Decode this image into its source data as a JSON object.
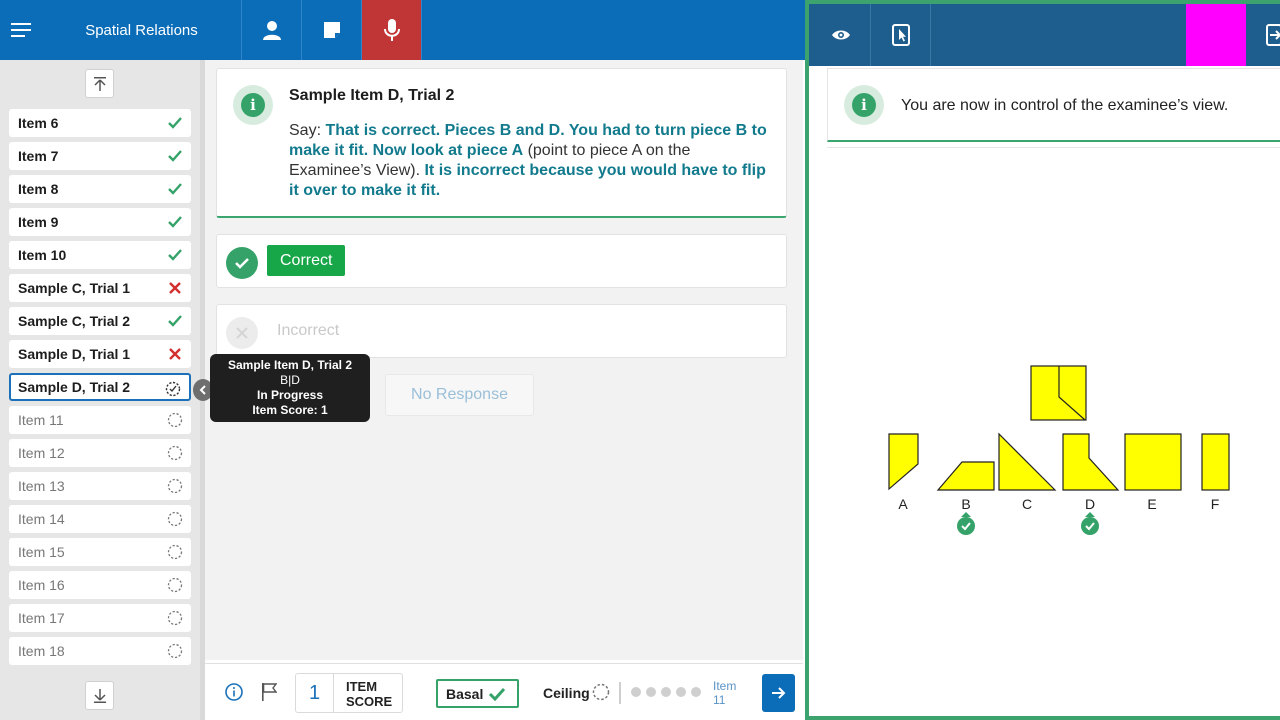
{
  "header": {
    "title": "Spatial Relations"
  },
  "sidebar": {
    "items": [
      {
        "label": "Item 6",
        "status": "correct"
      },
      {
        "label": "Item 7",
        "status": "correct"
      },
      {
        "label": "Item 8",
        "status": "correct"
      },
      {
        "label": "Item 9",
        "status": "correct"
      },
      {
        "label": "Item 10",
        "status": "correct"
      },
      {
        "label": "Sample C, Trial 1",
        "status": "incorrect"
      },
      {
        "label": "Sample C, Trial 2",
        "status": "correct"
      },
      {
        "label": "Sample D, Trial 1",
        "status": "incorrect"
      },
      {
        "label": "Sample D, Trial 2",
        "status": "in-progress"
      },
      {
        "label": "Item 11",
        "status": "pending"
      },
      {
        "label": "Item 12",
        "status": "pending"
      },
      {
        "label": "Item 13",
        "status": "pending"
      },
      {
        "label": "Item 14",
        "status": "pending"
      },
      {
        "label": "Item 15",
        "status": "pending"
      },
      {
        "label": "Item 16",
        "status": "pending"
      },
      {
        "label": "Item 17",
        "status": "pending"
      },
      {
        "label": "Item 18",
        "status": "pending"
      }
    ]
  },
  "instructions": {
    "title": "Sample Item D, Trial 2",
    "say_prefix": "Say: ",
    "say_1": "That is correct. Pieces B and D. You had to turn piece B to make it fit. Now look at piece A",
    "say_2": " (point to piece A on the Examinee’s View). ",
    "say_3": "It is incorrect because you would have to flip it over to make it fit."
  },
  "responses": {
    "correct_label": "Correct",
    "incorrect_label": "Incorrect",
    "no_response_label": "No Response"
  },
  "tooltip": {
    "title": "Sample Item D, Trial 2",
    "answer": "B|D",
    "status": "In Progress",
    "score": "Item Score: 1"
  },
  "footer": {
    "item_score_value": "1",
    "item_score_label_1": "ITEM",
    "item_score_label_2": "SCORE",
    "basal_label": "Basal",
    "ceiling_label": "Ceiling",
    "next_item_label_1": "Item",
    "next_item_label_2": "11"
  },
  "examinee_view": {
    "banner_text": "You are now in control of the examinee’s view.",
    "pieces": [
      "A",
      "B",
      "C",
      "D",
      "E",
      "F"
    ],
    "selected_pieces": [
      "B",
      "D"
    ]
  },
  "colors": {
    "primary": "#0b6cb8",
    "success": "#35a369",
    "error": "#d32f2f",
    "mic_active": "#c03535",
    "piece_fill": "#ffff00",
    "magenta": "#ff00ff"
  }
}
